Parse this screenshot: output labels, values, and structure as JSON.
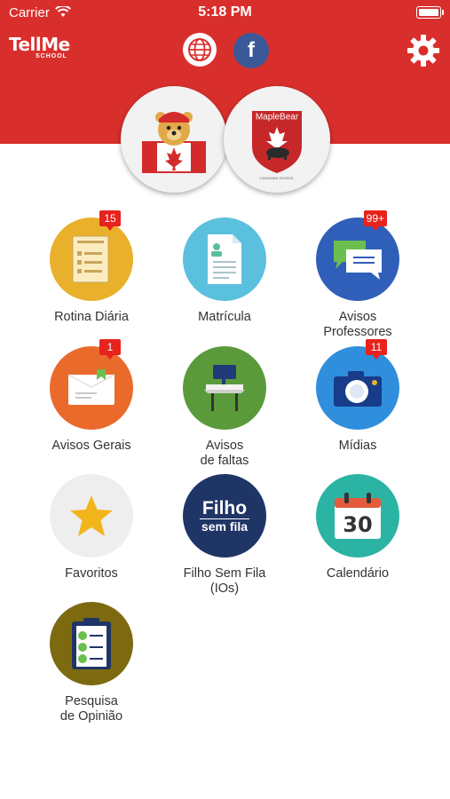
{
  "status_bar": {
    "carrier": "Carrier",
    "time": "5:18 PM"
  },
  "header": {
    "logo_top": "TellMe",
    "logo_bottom": "SCHOOL",
    "globe_icon": "globe-icon",
    "facebook_letter": "f",
    "settings_icon": "gear-icon",
    "color": "#d92f2c"
  },
  "schools": {
    "left": {
      "name": "canada-bear-logo"
    },
    "right": {
      "name_text": "MapleBear",
      "subtitle": "CANADIAN SCHOOL"
    }
  },
  "menu": [
    {
      "label": "Rotina Diária",
      "badge": "15",
      "color": "#e9b12b"
    },
    {
      "label": "Matrícula",
      "badge": "",
      "color": "#5bc0de"
    },
    {
      "label": "Avisos\nProfessores",
      "badge": "99+",
      "color": "#2f5fb8"
    },
    {
      "label": "Avisos Gerais",
      "badge": "1",
      "color": "#ea6a2b"
    },
    {
      "label": "Avisos\nde faltas",
      "badge": "",
      "color": "#5a9a3b"
    },
    {
      "label": "Mídias",
      "badge": "11",
      "color": "#2f8fdc"
    },
    {
      "label": "Favoritos",
      "badge": "",
      "color": "#eeeeee"
    },
    {
      "label": "Filho Sem Fila\n(IOs)",
      "badge": "",
      "color": "#1f3566",
      "icon_text_1": "Filho",
      "icon_text_2": "sem fila"
    },
    {
      "label": "Calendário",
      "badge": "",
      "color": "#2bb3a3",
      "icon_text": "30"
    },
    {
      "label": "Pesquisa\nde Opinião",
      "badge": "",
      "color": "#7d6a10"
    }
  ]
}
